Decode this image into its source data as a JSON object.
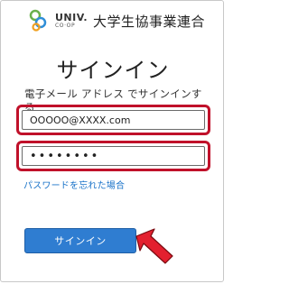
{
  "header": {
    "logo_univ": "UNIV.",
    "logo_coop": "CO·OP",
    "org_name": "大学生協事業連合"
  },
  "title": "サインイン",
  "instruction": "電子メール アドレス でサインインする",
  "email_field": {
    "value": "OOOOO@XXXX.com"
  },
  "password_field": {
    "value": "••••••••"
  },
  "forgot_password_link": "パスワードを忘れた場合",
  "signin_button": "サインイン",
  "colors": {
    "highlight_outline": "#c0112a",
    "button": "#2f7dd1",
    "link": "#1a73c9",
    "arrow": "#e3202f"
  }
}
